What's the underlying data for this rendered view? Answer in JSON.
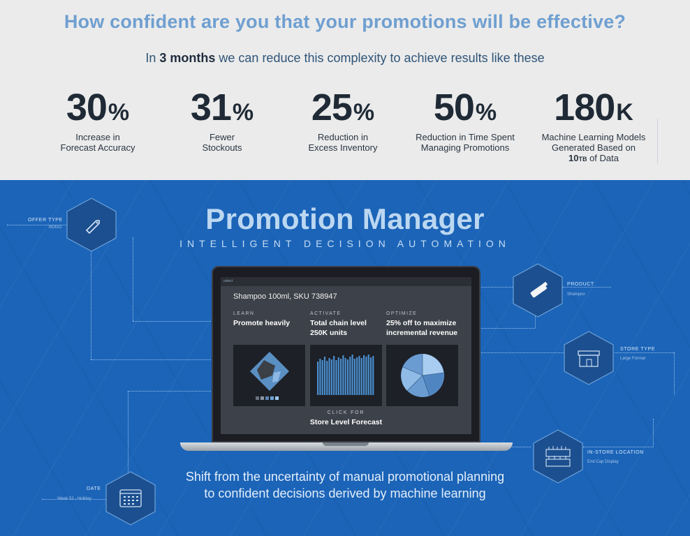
{
  "header": {
    "headline": "How confident are you that your promotions will be effective?",
    "sub_prefix": "In",
    "sub_bold": "3 months",
    "sub_suffix": "we can reduce this complexity to achieve results like these"
  },
  "stats": [
    {
      "value": "30",
      "unit": "%",
      "line1": "Increase in",
      "line2": "Forecast Accuracy"
    },
    {
      "value": "31",
      "unit": "%",
      "line1": "Fewer",
      "line2": "Stockouts"
    },
    {
      "value": "25",
      "unit": "%",
      "line1": "Reduction in",
      "line2": "Excess Inventory"
    },
    {
      "value": "50",
      "unit": "%",
      "line1": "Reduction in Time Spent",
      "line2": "Managing Promotions"
    },
    {
      "value": "180",
      "unit": "K",
      "line1": "Machine Learning Models",
      "line2": "Generated Based on",
      "line3_a": "10",
      "line3_b": "TB",
      "line3_c": " of Data"
    }
  ],
  "product": {
    "title": "Promotion Manager",
    "tagline": "INTELLIGENT DECISION AUTOMATION"
  },
  "nodes": {
    "offer": {
      "label": "OFFER TYPE",
      "value": "BOGO",
      "icon": "tag-icon"
    },
    "product": {
      "label": "PRODUCT",
      "value": "Shampoo",
      "icon": "tube-icon"
    },
    "store": {
      "label": "STORE TYPE",
      "value": "Large Format",
      "icon": "store-icon"
    },
    "location": {
      "label": "IN-STORE LOCATION",
      "value": "End Cap Display",
      "icon": "shelf-icon"
    },
    "date": {
      "label": "DATE",
      "value": "Week 52 - Holiday",
      "icon": "calendar-icon"
    }
  },
  "screen": {
    "logo": "celect",
    "sku": "Shampoo 100ml, SKU 738947",
    "columns": [
      {
        "key": "LEARN",
        "line1": "Promote heavily",
        "line2": ""
      },
      {
        "key": "ACTIVATE",
        "line1": "Total chain level",
        "line2": "250K units"
      },
      {
        "key": "OPTIMIZE",
        "line1": "25% off to maximize",
        "line2": "incremental revenue"
      }
    ],
    "click_key": "CLICK FOR",
    "click_value": "Store Level Forecast"
  },
  "footer": {
    "line1": "Shift from the uncertainty of manual promotional planning",
    "line2": "to confident decisions derived by machine learning"
  },
  "colors": {
    "headline": "#6f9fd0",
    "blue_bg": "#1b64b8",
    "title": "#bcd7f1",
    "bars": "#4a8fd0",
    "pie": "#7fb2e0"
  }
}
